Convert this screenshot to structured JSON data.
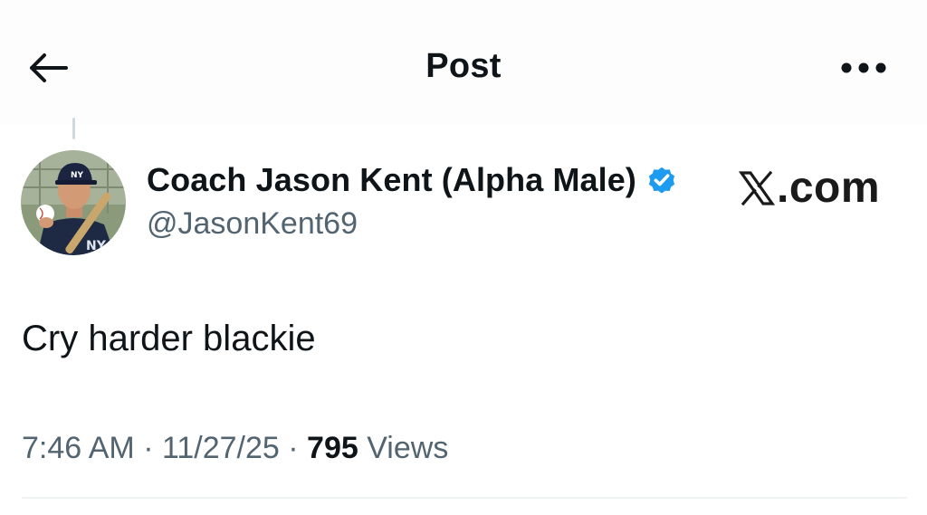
{
  "header": {
    "title": "Post",
    "back_icon": "arrow-left-icon",
    "more_icon": "more-horizontal-icon"
  },
  "author": {
    "display_name": "Coach Jason Kent (Alpha Male)",
    "handle": "@JasonKent69",
    "verified": true,
    "verified_color": "#1d9bf0",
    "avatar_icon": "avatar-photo"
  },
  "watermark": {
    "logo_icon": "x-logo-icon",
    "text": ".com"
  },
  "post": {
    "text": "Cry harder blackie"
  },
  "meta": {
    "time": "7:46 AM",
    "separator": "·",
    "date": "11/27/25",
    "views_count": "795",
    "views_label": "Views"
  },
  "colors": {
    "text_primary": "#0f1419",
    "text_secondary": "#536471",
    "divider": "#eff3f4"
  }
}
